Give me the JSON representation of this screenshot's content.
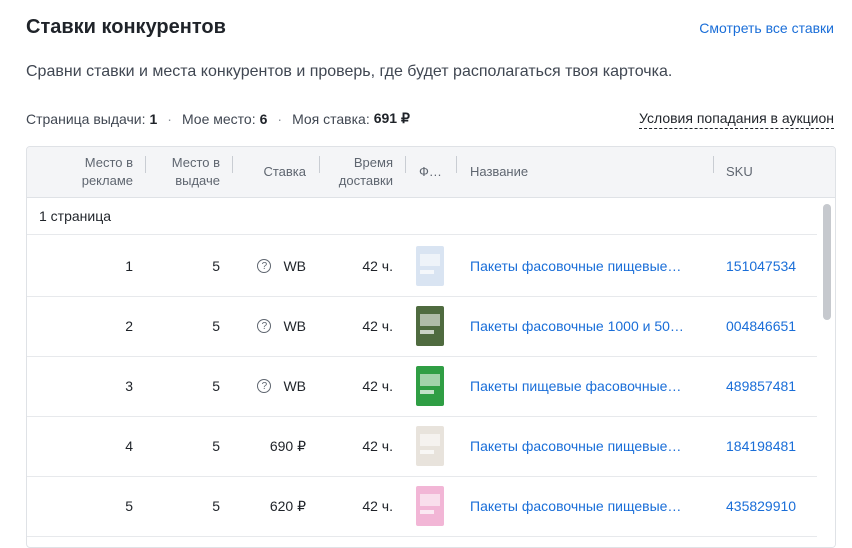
{
  "header": {
    "title": "Ставки конкурентов",
    "see_all": "Смотреть все ставки",
    "subtitle": "Сравни ставки и места конкурентов и проверь, где будет располагаться твоя карточка."
  },
  "stats": {
    "page_label": "Страница выдачи:",
    "page_value": "1",
    "place_label": "Мое место:",
    "place_value": "6",
    "bid_label": "Моя ставка:",
    "bid_value": "691 ₽",
    "conditions_link": "Условия попадания в аукцион"
  },
  "table": {
    "columns": {
      "ad_place_1": "Место в",
      "ad_place_2": "рекламе",
      "search_place_1": "Место в",
      "search_place_2": "выдаче",
      "bid": "Ставка",
      "delivery_1": "Время",
      "delivery_2": "доставки",
      "photo": "Ф…",
      "name": "Название",
      "sku": "SKU"
    },
    "page_group": "1 страница",
    "rows": [
      {
        "ad_place": "1",
        "search_place": "5",
        "bid": "WB",
        "bid_icon": true,
        "delivery": "42 ч.",
        "name": "Пакеты фасовочные пищевые…",
        "sku": "151047534",
        "thumb_color": "#d9e4f2"
      },
      {
        "ad_place": "2",
        "search_place": "5",
        "bid": "WB",
        "bid_icon": true,
        "delivery": "42 ч.",
        "name": "Пакеты фасовочные 1000 и 50…",
        "sku": "004846651",
        "thumb_color": "#4f6b3f"
      },
      {
        "ad_place": "3",
        "search_place": "5",
        "bid": "WB",
        "bid_icon": true,
        "delivery": "42 ч.",
        "name": "Пакеты пищевые фасовочные…",
        "sku": "489857481",
        "thumb_color": "#2f9e44"
      },
      {
        "ad_place": "4",
        "search_place": "5",
        "bid": "690 ₽",
        "bid_icon": false,
        "delivery": "42 ч.",
        "name": "Пакеты фасовочные пищевые…",
        "sku": "184198481",
        "thumb_color": "#e8e3dc"
      },
      {
        "ad_place": "5",
        "search_place": "5",
        "bid": "620 ₽",
        "bid_icon": false,
        "delivery": "42 ч.",
        "name": "Пакеты фасовочные пищевые…",
        "sku": "435829910",
        "thumb_color": "#f2b6d6"
      }
    ]
  }
}
